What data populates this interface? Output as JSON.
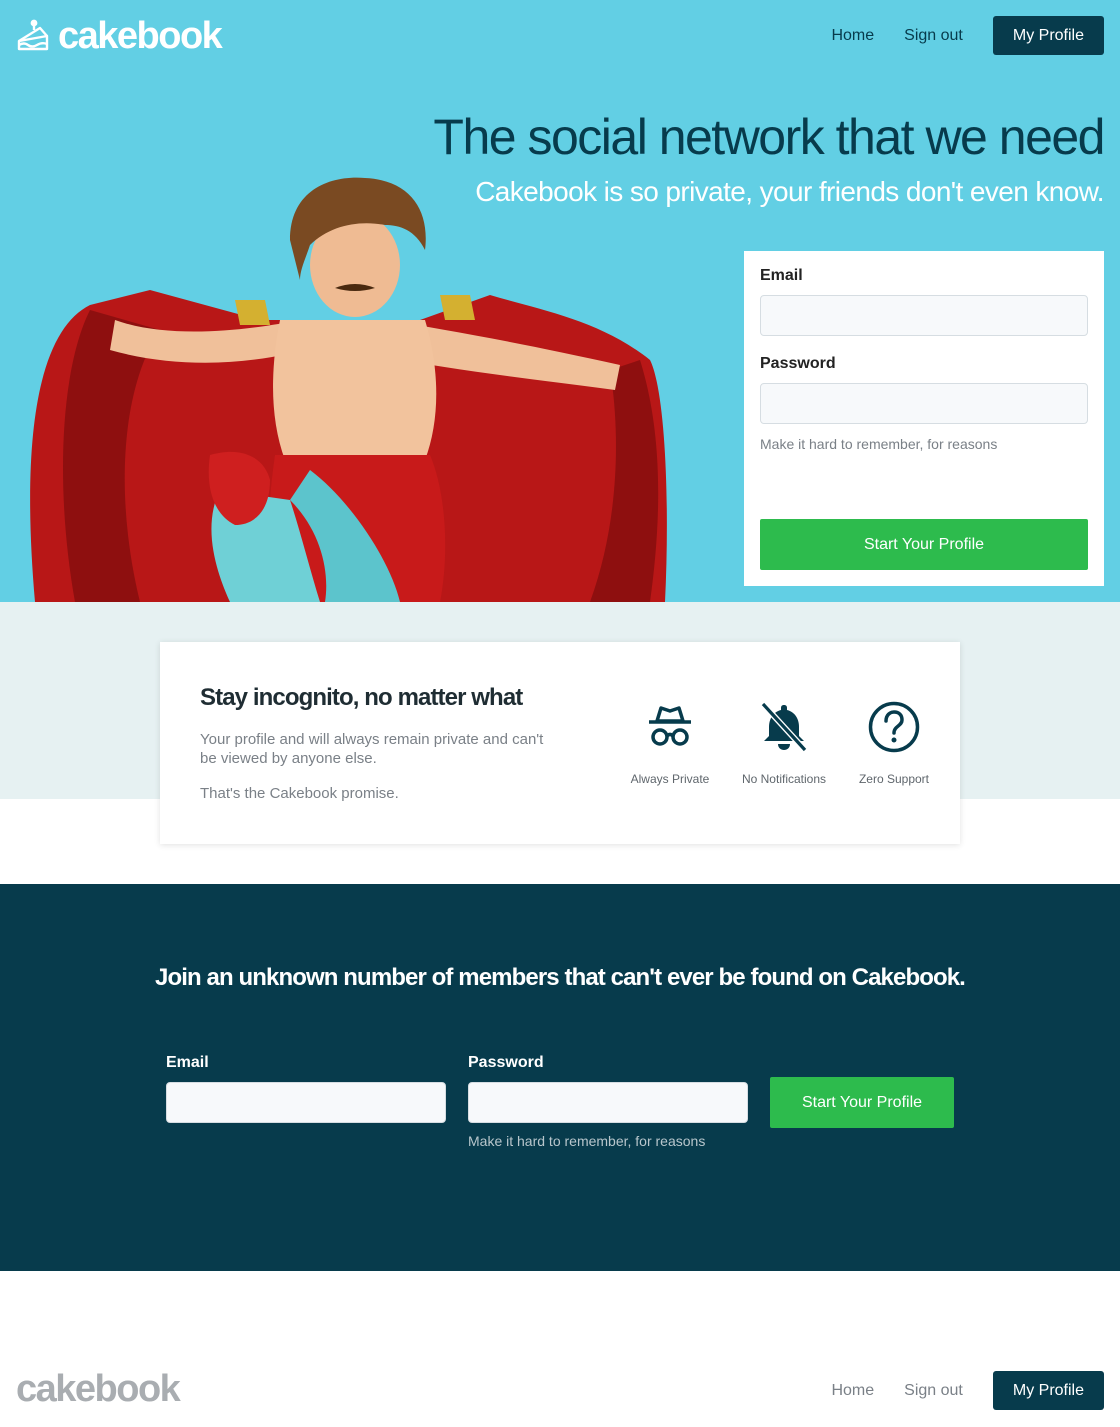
{
  "brand": {
    "name": "cakebook",
    "colors": {
      "primary": "#62cfe4",
      "dark": "#073b4c",
      "accent": "#2dbb4d"
    }
  },
  "nav": {
    "home": "Home",
    "sign_out": "Sign out",
    "profile": "My Profile"
  },
  "hero": {
    "title": "The social network that we need",
    "subtitle": "Cakebook is so private, your friends don't even know.",
    "form": {
      "email_label": "Email",
      "email_value": "",
      "password_label": "Password",
      "password_value": "",
      "password_hint": "Make it hard to remember, for reasons",
      "submit": "Start Your Profile"
    }
  },
  "features": {
    "title": "Stay incognito, no matter what",
    "body": "Your profile and will always remain private and can't be viewed by anyone else.",
    "promise": "That's the Cakebook promise.",
    "items": [
      {
        "icon": "incognito-icon",
        "label": "Always Private"
      },
      {
        "icon": "bell-slash-icon",
        "label": "No Notifications"
      },
      {
        "icon": "question-circle-icon",
        "label": "Zero Support"
      }
    ]
  },
  "join": {
    "title": "Join an unknown number of members that can't ever be found on Cakebook.",
    "email_label": "Email",
    "password_label": "Password",
    "password_hint": "Make it hard to remember, for reasons",
    "submit": "Start Your Profile"
  },
  "footer": {
    "logo": "cakebook",
    "home": "Home",
    "sign_out": "Sign out",
    "profile": "My Profile"
  }
}
